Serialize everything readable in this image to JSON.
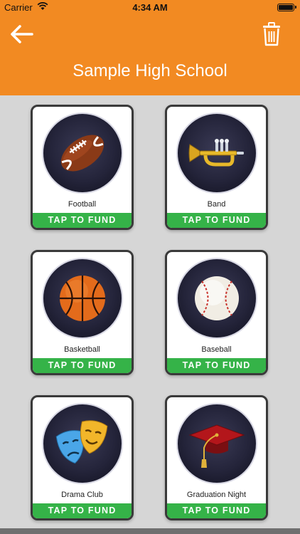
{
  "status": {
    "carrier": "Carrier",
    "time": "4:34 AM"
  },
  "header": {
    "title": "Sample High School"
  },
  "cards": [
    {
      "name": "Football",
      "button": "TAP TO FUND",
      "icon": "football-icon"
    },
    {
      "name": "Band",
      "button": "TAP TO FUND",
      "icon": "trumpet-icon"
    },
    {
      "name": "Basketball",
      "button": "TAP TO FUND",
      "icon": "basketball-icon"
    },
    {
      "name": "Baseball",
      "button": "TAP TO FUND",
      "icon": "baseball-icon"
    },
    {
      "name": "Drama Club",
      "button": "TAP TO FUND",
      "icon": "theater-masks-icon"
    },
    {
      "name": "Graduation Night",
      "button": "TAP TO FUND",
      "icon": "graduation-cap-icon"
    }
  ],
  "colors": {
    "header": "#f28a22",
    "fund_button": "#35b348",
    "background": "#d6d6d6"
  }
}
